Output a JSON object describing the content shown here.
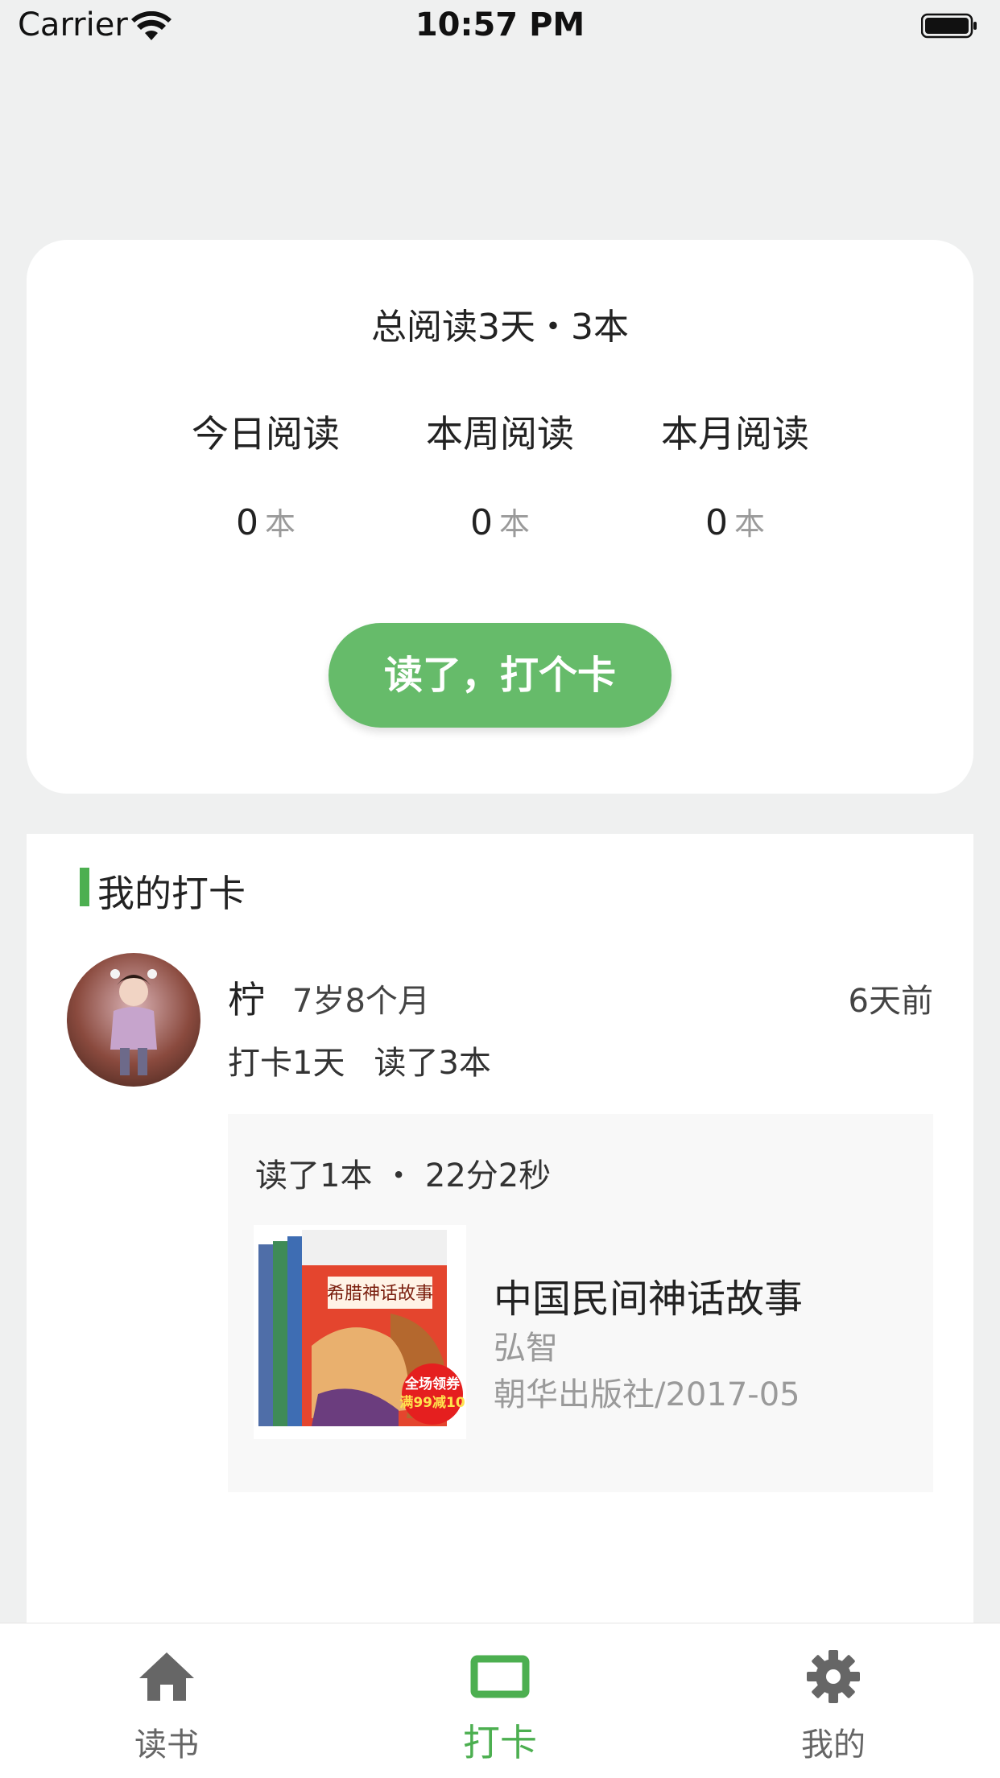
{
  "status_bar": {
    "carrier": "Carrier",
    "time": "10:57 PM"
  },
  "summary": {
    "title": "总阅读3天・3本",
    "stats": [
      {
        "label": "今日阅读",
        "value": "0",
        "unit": "本"
      },
      {
        "label": "本周阅读",
        "value": "0",
        "unit": "本"
      },
      {
        "label": "本月阅读",
        "value": "0",
        "unit": "本"
      }
    ],
    "checkin_button": "读了，打个卡"
  },
  "my_checkins": {
    "title": "我的打卡",
    "entry": {
      "name": "柠",
      "age": "7岁8个月",
      "time_ago": "6天前",
      "days": "打卡1天",
      "books_read": "读了3本",
      "record_summary": "读了1本 ・ 22分2秒",
      "book": {
        "title": "中国民间神话故事",
        "author": "弘智",
        "publisher": "朝华出版社/2017-05",
        "cover_main_title": "希腊神话故事",
        "cover_badge_line1": "全场领券",
        "cover_badge_line2": "满99减10"
      }
    }
  },
  "tab_bar": {
    "items": [
      {
        "label": "读书",
        "icon": "home-icon",
        "active": false
      },
      {
        "label": "打卡",
        "icon": "checkin-icon",
        "active": true
      },
      {
        "label": "我的",
        "icon": "gear-icon",
        "active": false
      }
    ]
  },
  "colors": {
    "accent": "#66bb6a",
    "accent_dark": "#4caf50",
    "background": "#eff0f0",
    "tab_inactive": "#666666"
  }
}
